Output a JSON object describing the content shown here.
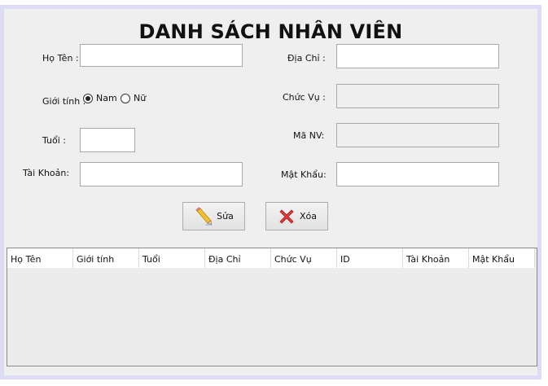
{
  "form": {
    "title": "DANH SÁCH NHÂN VIÊN",
    "labels": {
      "ho_ten": "Họ Tên :",
      "gioi_tinh": "Giới tính :",
      "tuoi": "Tuổi :",
      "tai_khoan": "Tài Khoản:",
      "dia_chi": "Địa Chỉ :",
      "chuc_vu": "Chức Vụ :",
      "ma_nv": "Mã NV:",
      "mat_khau": "Mật Khẩu:"
    },
    "fields": {
      "ho_ten": "",
      "tuoi": "",
      "tai_khoan": "",
      "dia_chi": "",
      "chuc_vu": "",
      "ma_nv": "",
      "mat_khau": ""
    },
    "gender_options": [
      {
        "label": "Nam",
        "selected": true
      },
      {
        "label": "Nữ",
        "selected": false
      }
    ]
  },
  "buttons": {
    "edit_label": "Sửa",
    "delete_label": "Xóa"
  },
  "table": {
    "columns": [
      "Họ Tên",
      "Giới tính",
      "Tuổi",
      "Địa Chỉ",
      "Chức Vụ",
      "ID",
      "Tài Khoản",
      "Mật Khẩu"
    ],
    "rows": []
  },
  "icons": {
    "edit": "pencil-icon",
    "delete": "red-x-icon"
  }
}
